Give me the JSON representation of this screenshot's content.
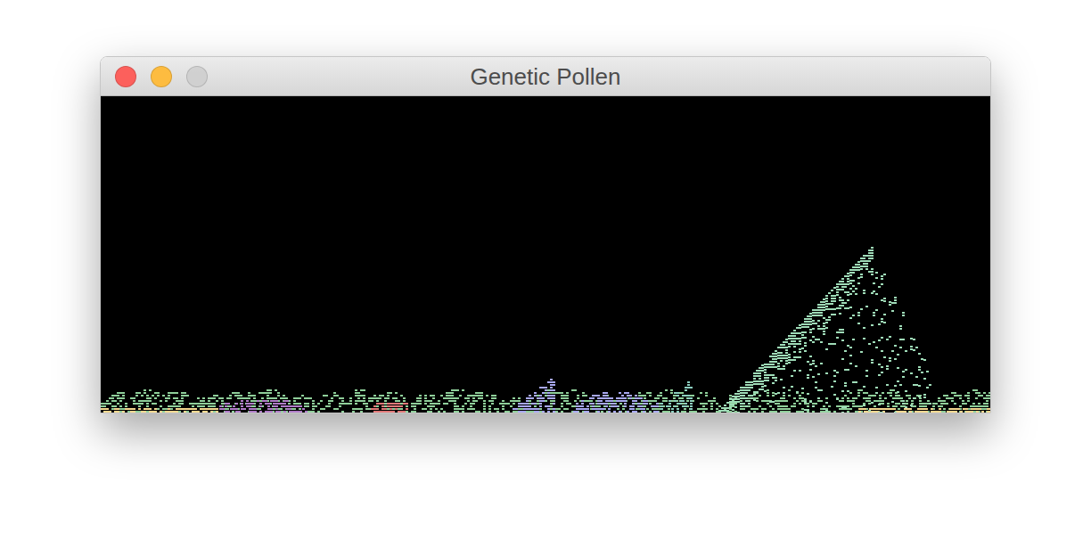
{
  "window": {
    "title": "Genetic Pollen"
  },
  "controls": [
    {
      "kind": "close",
      "disabled": false,
      "color": "#fc605c"
    },
    {
      "kind": "minimize",
      "disabled": false,
      "color": "#fdbc40"
    },
    {
      "kind": "zoom",
      "disabled": true,
      "color": "#cfcfcf"
    }
  ],
  "canvas": {
    "background": "#000000"
  },
  "plants": [
    {
      "kind": "grass",
      "color": "#8fcf9a"
    },
    {
      "kind": "moss",
      "color": "#f5d890"
    },
    {
      "kind": "shrub",
      "color": "#b07cc8"
    },
    {
      "kind": "shrub",
      "color": "#e07878"
    },
    {
      "kind": "shrub",
      "color": "#a8a8f0"
    },
    {
      "kind": "shrub",
      "color": "#8ccfc0"
    },
    {
      "kind": "tree",
      "color": "#9fdcb8"
    }
  ]
}
